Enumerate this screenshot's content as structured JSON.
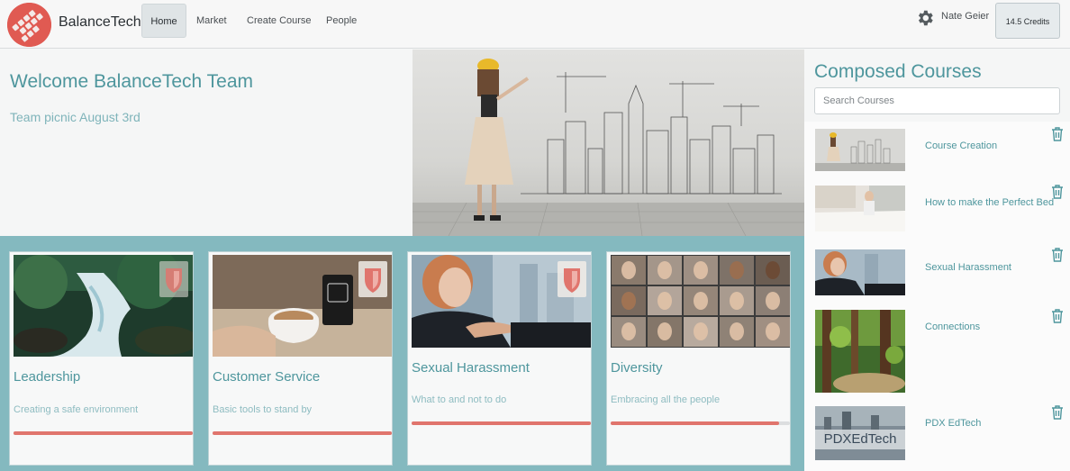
{
  "app": {
    "brand": "BalanceTech",
    "colors": {
      "accent": "#4e969d",
      "brand_red": "#e05a52",
      "progress": "#e0756d",
      "teal_band": "#84b9bf"
    }
  },
  "nav": {
    "items": [
      {
        "label": "Home",
        "active": true
      },
      {
        "label": "Market",
        "active": false
      },
      {
        "label": "Create Course",
        "active": false
      },
      {
        "label": "People",
        "active": false
      }
    ],
    "user_name": "Nate Geier",
    "credits": "14.5 Credits",
    "settings_icon": "gear-icon"
  },
  "welcome": {
    "title": "Welcome BalanceTech Team",
    "subtitle": "Team picnic August 3rd"
  },
  "cards": [
    {
      "title": "Leadership",
      "description": "Creating a safe environment",
      "progress": 1.0,
      "badge": true
    },
    {
      "title": "Customer Service",
      "description": "Basic tools to stand by",
      "progress": 1.0,
      "badge": true
    },
    {
      "title": "Sexual Harassment",
      "description": "What to and not to do",
      "progress": 1.0,
      "badge": true
    },
    {
      "title": "Diversity",
      "description": "Embracing all the people",
      "progress": 0.94,
      "badge": false
    }
  ],
  "sidebar": {
    "title": "Composed Courses",
    "search_placeholder": "Search Courses",
    "courses": [
      {
        "name": "Course Creation"
      },
      {
        "name": "How to make the Perfect Bed"
      },
      {
        "name": "Sexual Harassment"
      },
      {
        "name": "Connections"
      },
      {
        "name": "PDX EdTech",
        "thumb_text": "PDXEdTech"
      }
    ],
    "delete_icon": "trash-icon"
  }
}
